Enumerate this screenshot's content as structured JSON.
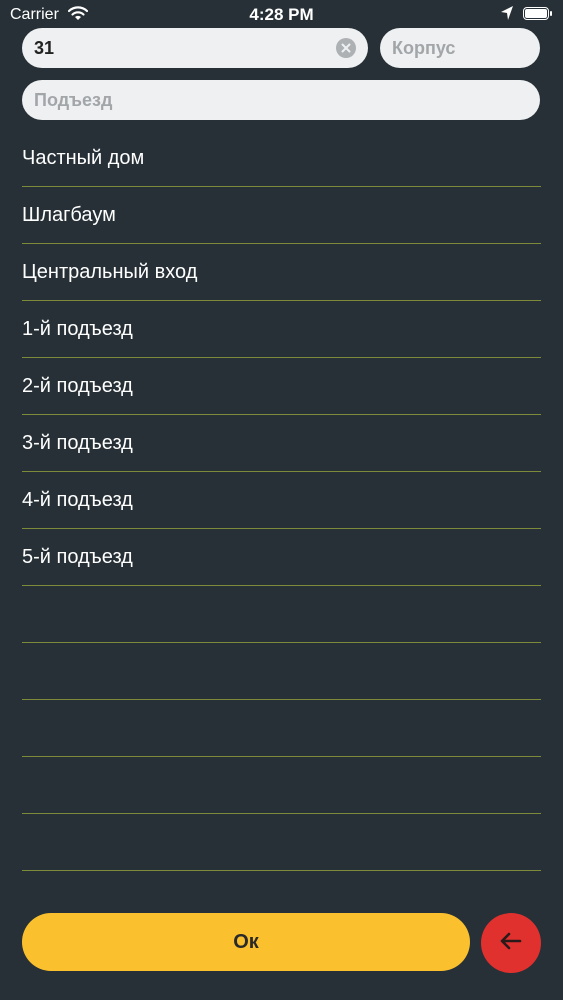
{
  "status_bar": {
    "carrier": "Carrier",
    "time": "4:28 PM"
  },
  "form": {
    "house_value": "31",
    "corpus_placeholder": "Корпус",
    "entrance_placeholder": "Подъезд"
  },
  "entrance_list": [
    "Частный дом",
    "Шлагбаум",
    "Центральный вход",
    "1-й подъезд",
    "2-й подъезд",
    "3-й подъезд",
    "4-й подъезд",
    "5-й подъезд",
    "",
    "",
    "",
    "",
    ""
  ],
  "actions": {
    "ok_label": "Ок"
  },
  "colors": {
    "background": "#263036",
    "accent": "#fbc02d",
    "back": "#e0312f",
    "divider": "#7d8a3a"
  },
  "icons": [
    "wifi-icon",
    "location-arrow-icon",
    "battery-icon",
    "clear-icon",
    "arrow-left-icon"
  ]
}
